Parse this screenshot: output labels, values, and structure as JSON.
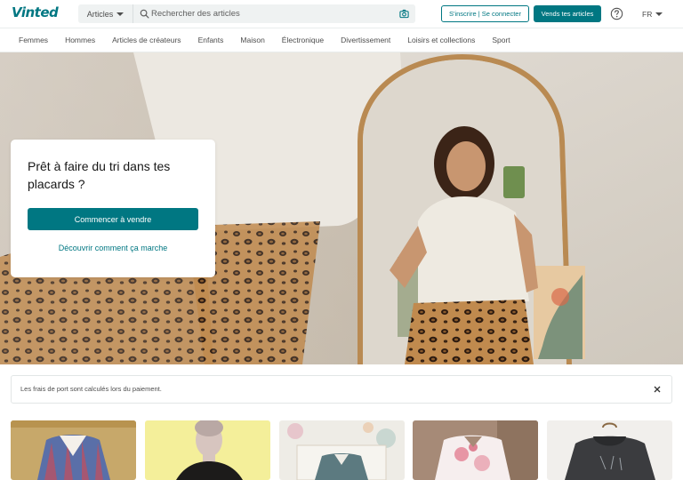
{
  "header": {
    "logo": "Vinted",
    "search": {
      "category": "Articles",
      "placeholder": "Rechercher des articles",
      "value": ""
    },
    "signin_label": "S'inscrire | Se connecter",
    "sell_label": "Vends tes articles",
    "language": "FR"
  },
  "nav": {
    "items": [
      "Femmes",
      "Hommes",
      "Articles de créateurs",
      "Enfants",
      "Maison",
      "Électronique",
      "Divertissement",
      "Loisirs et collections",
      "Sport"
    ]
  },
  "hero": {
    "title": "Prêt à faire du tri dans tes placards ?",
    "cta_label": "Commencer à vendre",
    "link_label": "Découvrir comment ça marche"
  },
  "notice": {
    "text": "Les frais de port sont calculés lors du paiement."
  },
  "items_count_visible": 5,
  "colors": {
    "brand": "#007782",
    "text": "#171717",
    "muted": "#4d4d4d",
    "search_bg": "#eff2f2"
  }
}
